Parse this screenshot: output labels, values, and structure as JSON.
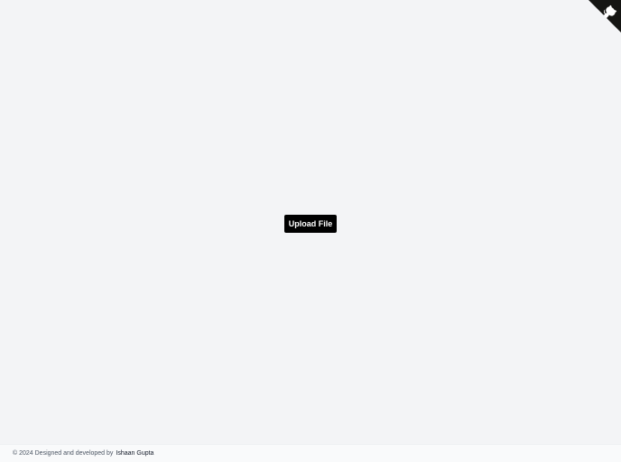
{
  "main": {
    "upload_button_label": "Upload File"
  },
  "corner": {
    "icon": "github-octocat-icon",
    "color": "#151513"
  },
  "footer": {
    "text": "© 2024 Designed and developed by",
    "author": "Ishaan Gupta"
  },
  "colors": {
    "background": "#f3f4f6",
    "button": "#000000",
    "button_text": "#ffffff"
  }
}
